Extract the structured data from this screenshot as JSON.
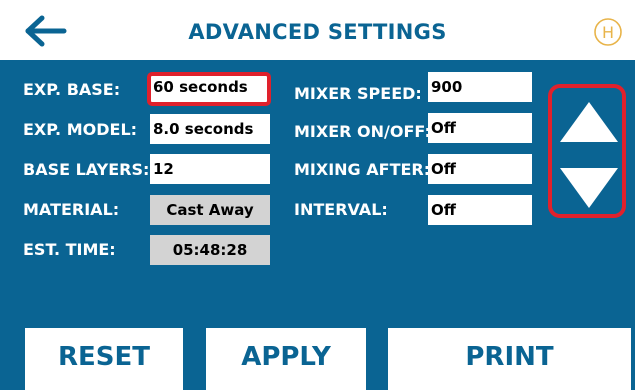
{
  "header": {
    "title": "ADVANCED SETTINGS",
    "back_icon": "arrow-left-icon",
    "logo_letter": "H",
    "logo_color": "#e8b44a"
  },
  "settings_left": [
    {
      "label": "EXP. BASE:",
      "value": "60 seconds",
      "selected": true,
      "readonly": false
    },
    {
      "label": "EXP. MODEL:",
      "value": "8.0 seconds",
      "selected": false,
      "readonly": false
    },
    {
      "label": "BASE LAYERS:",
      "value": "12",
      "selected": false,
      "readonly": false
    },
    {
      "label": "MATERIAL:",
      "value": "Cast Away",
      "selected": false,
      "readonly": true
    },
    {
      "label": "EST. TIME:",
      "value": "05:48:28",
      "selected": false,
      "readonly": true
    }
  ],
  "settings_right": [
    {
      "label": "MIXER SPEED:",
      "value": "900"
    },
    {
      "label": "MIXER ON/OFF:",
      "value": "Off"
    },
    {
      "label": "MIXING AFTER:",
      "value": "Off"
    },
    {
      "label": "INTERVAL:",
      "value": "Off"
    }
  ],
  "stepper": {
    "up_icon": "triangle-up-icon",
    "down_icon": "triangle-down-icon"
  },
  "buttons": {
    "reset": "RESET",
    "apply": "APPLY",
    "print": "PRINT"
  },
  "colors": {
    "background": "#0a6493",
    "highlight": "#e0212c",
    "readonly_field": "#d3d3d3"
  }
}
